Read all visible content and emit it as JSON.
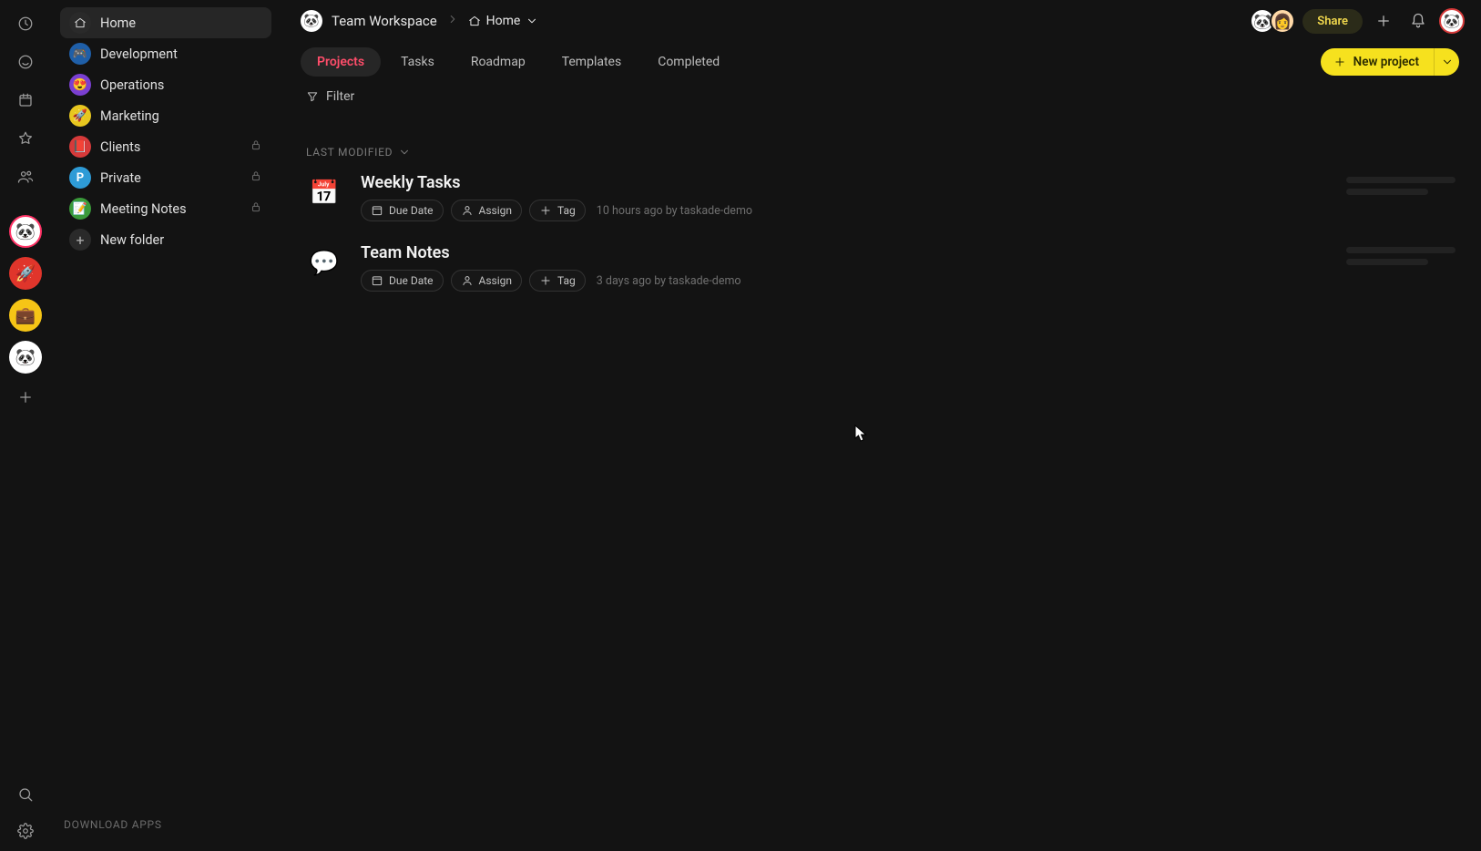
{
  "rail": {
    "top_icons": [
      "clock",
      "check-circle",
      "calendar",
      "star",
      "users"
    ],
    "workspaces": [
      {
        "id": "current",
        "emoji": "🐼",
        "style": "current"
      },
      {
        "id": "rocket",
        "emoji": "🚀",
        "style": "rocket"
      },
      {
        "id": "brief",
        "emoji": "💼",
        "style": "briefcase"
      },
      {
        "id": "plain",
        "emoji": "🐼",
        "style": "plain"
      }
    ]
  },
  "sidebar": {
    "folders": [
      {
        "label": "Home",
        "icon_svg": "home",
        "color": "#2a2a2a",
        "active": true,
        "locked": false
      },
      {
        "label": "Development",
        "icon_svg": null,
        "emoji": "🎮",
        "color": "#1f5fa8",
        "active": false,
        "locked": false
      },
      {
        "label": "Operations",
        "icon_svg": null,
        "emoji": "😍",
        "color": "#7a3fd1",
        "active": false,
        "locked": false
      },
      {
        "label": "Marketing",
        "icon_svg": null,
        "emoji": "🚀",
        "color": "#e8c71f",
        "active": false,
        "locked": false
      },
      {
        "label": "Clients",
        "icon_svg": null,
        "emoji": "📕",
        "color": "#d63a3a",
        "active": false,
        "locked": true
      },
      {
        "label": "Private",
        "icon_svg": null,
        "emoji": "P",
        "color": "#2e9bd6",
        "active": false,
        "locked": true,
        "text_icon": true
      },
      {
        "label": "Meeting Notes",
        "icon_svg": null,
        "emoji": "📝",
        "color": "#3a9a3a",
        "active": false,
        "locked": true
      }
    ],
    "new_folder_label": "New folder",
    "download_apps": "DOWNLOAD APPS"
  },
  "breadcrumb": {
    "workspace": "Team Workspace",
    "current": "Home"
  },
  "topbar": {
    "share": "Share"
  },
  "tabs": [
    "Projects",
    "Tasks",
    "Roadmap",
    "Templates",
    "Completed"
  ],
  "active_tab_index": 0,
  "filter_label": "Filter",
  "new_project_label": "New project",
  "section_sort": "LAST MODIFIED",
  "projects": [
    {
      "emoji": "📅",
      "title": "Weekly Tasks",
      "due_label": "Due Date",
      "assign_label": "Assign",
      "tag_label": "Tag",
      "timestamp": "10 hours ago by taskade-demo"
    },
    {
      "emoji": "💬",
      "title": "Team Notes",
      "due_label": "Due Date",
      "assign_label": "Assign",
      "tag_label": "Tag",
      "timestamp": "3 days ago by taskade-demo"
    }
  ]
}
